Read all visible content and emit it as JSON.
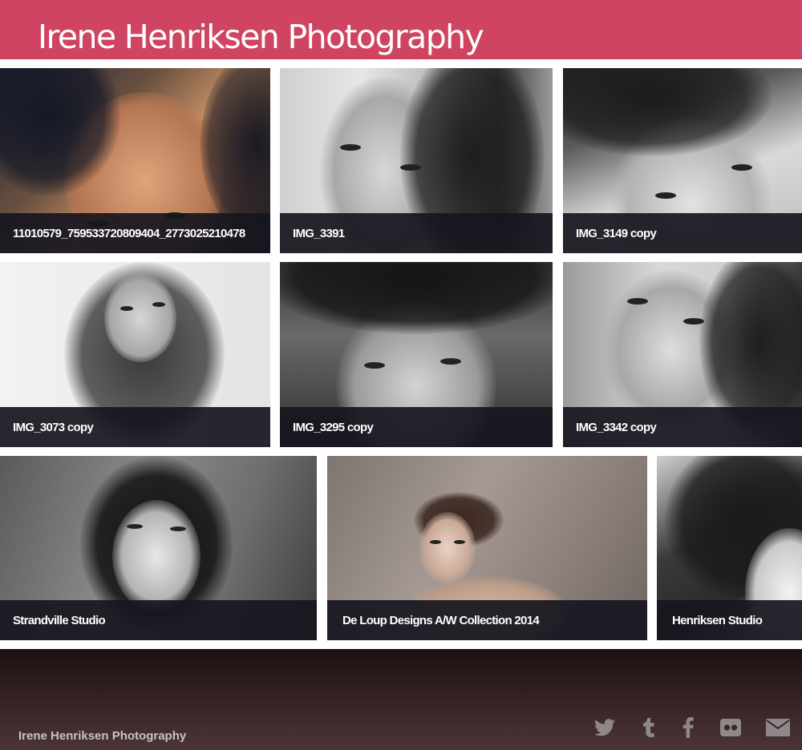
{
  "header": {
    "site_title": "Irene Henriksen Photography",
    "background_color": "#cf4561"
  },
  "gallery": {
    "tiles": [
      {
        "caption": "11010579_759533720809404_2773025210478"
      },
      {
        "caption": "IMG_3391"
      },
      {
        "caption": "IMG_3149 copy"
      },
      {
        "caption": "IMG_3073 copy"
      },
      {
        "caption": "IMG_3295 copy"
      },
      {
        "caption": "IMG_3342 copy"
      },
      {
        "caption": "Strandville Studio"
      },
      {
        "caption": "De Loup Designs A/W Collection 2014"
      },
      {
        "caption": "Henriksen Studio"
      }
    ]
  },
  "footer": {
    "title": "Irene Henriksen Photography",
    "social_icons": [
      "twitter-icon",
      "tumblr-icon",
      "facebook-icon",
      "flickr-icon",
      "email-icon"
    ]
  }
}
